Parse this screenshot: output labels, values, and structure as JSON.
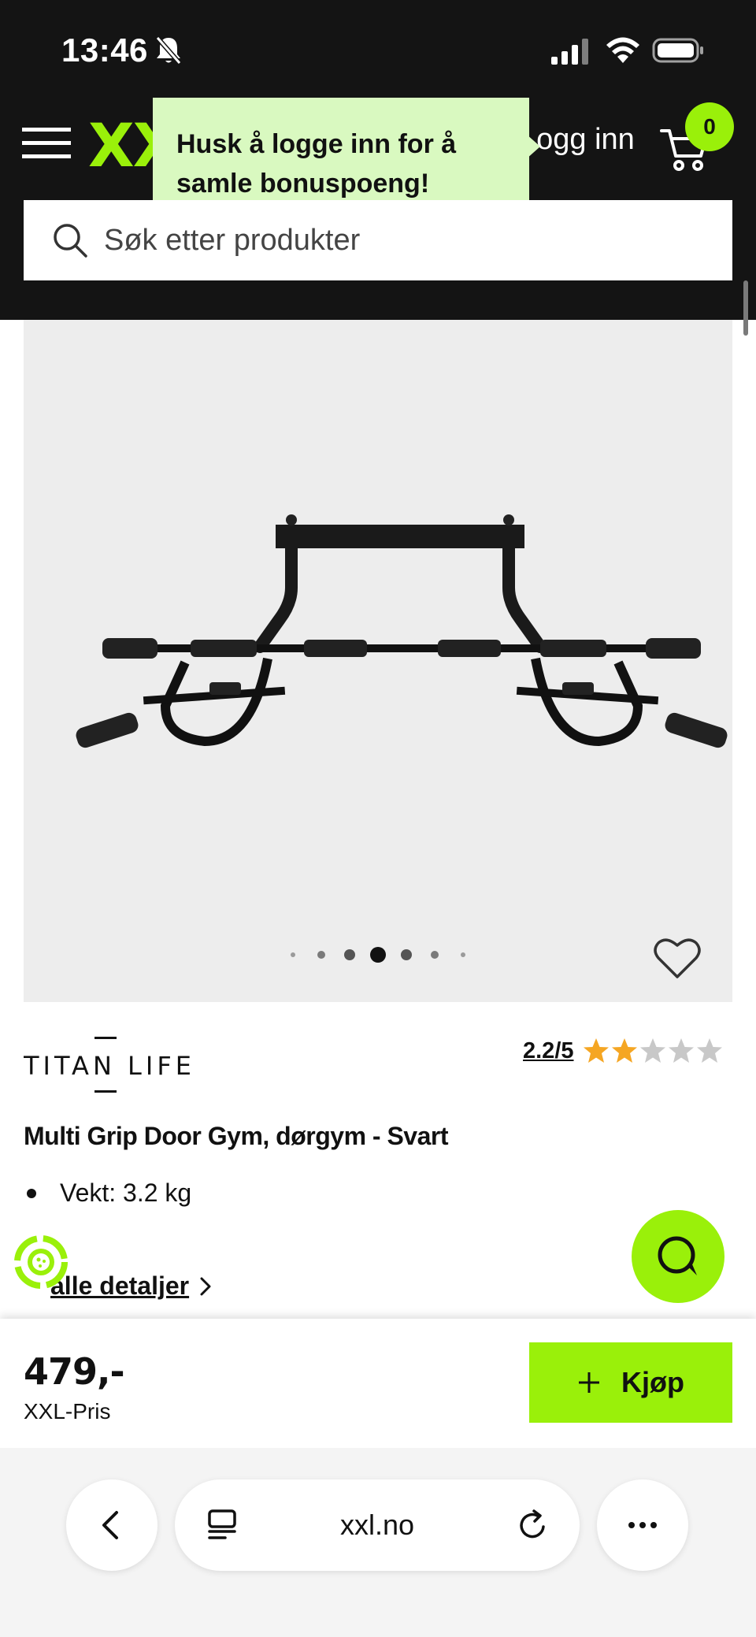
{
  "status_bar": {
    "time": "13:46"
  },
  "header": {
    "logo_text": "XXL",
    "login_label": "Logg inn",
    "cart_count": "0",
    "tooltip_text": "Husk å logge inn for å samle bonuspoeng!",
    "brand_color": "#9af00a"
  },
  "search": {
    "placeholder": "Søk etter produkter"
  },
  "product": {
    "brand": "TITAN LIFE®",
    "rating_text": "2.2/5",
    "rating_value": 2.2,
    "rating_max": 5,
    "title": "Multi Grip Door Gym, dørgym - Svart",
    "specs": [
      "Vekt: 3.2 kg"
    ],
    "details_link": "alle detaljer",
    "image_count": 7,
    "active_image_index": 3
  },
  "buy": {
    "price": "479,-",
    "price_label": "XXL-Pris",
    "button_label": "Kjøp"
  },
  "browser": {
    "url": "xxl.no"
  },
  "icons": {
    "menu": "hamburger-menu-icon",
    "cart": "shopping-cart-icon",
    "search": "search-icon",
    "favorite": "heart-icon",
    "chat": "chat-icon",
    "back": "chevron-left-icon",
    "tabs": "tabs-icon",
    "reload": "reload-icon",
    "more": "more-icon"
  }
}
